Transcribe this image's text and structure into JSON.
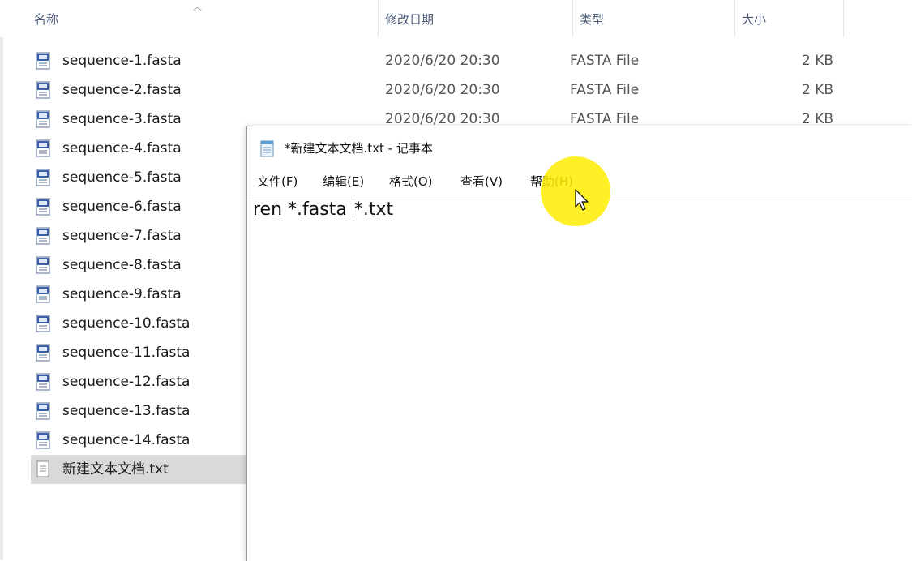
{
  "explorer": {
    "columns": {
      "name": "名称",
      "date": "修改日期",
      "type": "类型",
      "size": "大小"
    },
    "files": [
      {
        "name": "sequence-1.fasta",
        "date": "2020/6/20 20:30",
        "type": "FASTA File",
        "size": "2 KB"
      },
      {
        "name": "sequence-2.fasta",
        "date": "2020/6/20 20:30",
        "type": "FASTA File",
        "size": "2 KB"
      },
      {
        "name": "sequence-3.fasta",
        "date": "2020/6/20 20:30",
        "type": "FASTA File",
        "size": "2 KB"
      },
      {
        "name": "sequence-4.fasta"
      },
      {
        "name": "sequence-5.fasta"
      },
      {
        "name": "sequence-6.fasta"
      },
      {
        "name": "sequence-7.fasta"
      },
      {
        "name": "sequence-8.fasta"
      },
      {
        "name": "sequence-9.fasta"
      },
      {
        "name": "sequence-10.fasta"
      },
      {
        "name": "sequence-11.fasta"
      },
      {
        "name": "sequence-12.fasta"
      },
      {
        "name": "sequence-13.fasta"
      },
      {
        "name": "sequence-14.fasta"
      },
      {
        "name": "新建文本文档.txt"
      }
    ]
  },
  "notepad": {
    "title": "*新建文本文档.txt - 记事本",
    "menu": [
      "文件(F)",
      "编辑(E)",
      "格式(O)",
      "查看(V)",
      "帮助(H)"
    ],
    "text_before_caret": "ren *.fasta ",
    "text_after_caret": "*.txt"
  },
  "colors": {
    "header_text": "#4b5a78",
    "selection": "#d9d9d9",
    "cursor_highlight": "#ffec00"
  }
}
